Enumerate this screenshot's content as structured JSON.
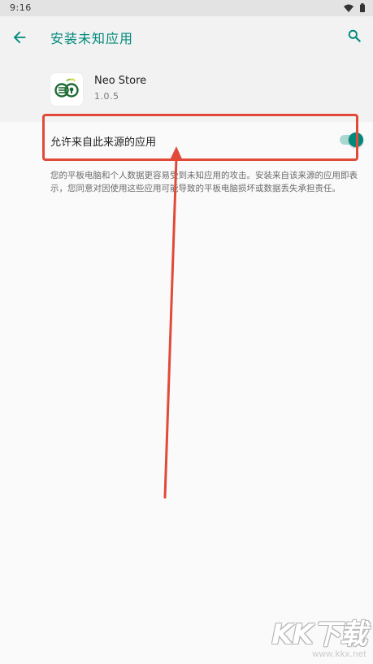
{
  "status_bar": {
    "time": "9:16",
    "icons": [
      "wifi-icon",
      "battery-icon"
    ]
  },
  "app_bar": {
    "title": "安装未知应用",
    "back_icon": "arrow-back-icon",
    "search_icon": "search-icon"
  },
  "app": {
    "name": "Neo Store",
    "version": "1.0.5"
  },
  "setting": {
    "label": "允许来自此来源的应用",
    "enabled": true
  },
  "description": "您的平板电脑和个人数据更容易受到未知应用的攻击。安装来自该来源的应用即表示，您同意对因使用这些应用可能导致的平板电脑损坏或数据丢失承担责任。",
  "watermark": {
    "logo": "KK下载",
    "url": "www.kkx.net"
  },
  "colors": {
    "accent": "#00897b",
    "switch_track": "#a9d8d3",
    "annotation": "#e14a39",
    "header_bg": "#f2f2f2",
    "background": "#fafafa"
  }
}
